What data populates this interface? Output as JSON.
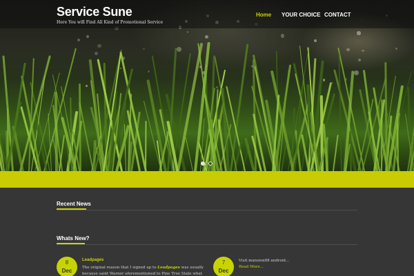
{
  "header": {
    "site_title": "Service Sune",
    "tagline": "Here You will Find All Kind of Promotional Service"
  },
  "nav": [
    {
      "label": "Home",
      "active": true
    },
    {
      "label": "YOUR CHOICE",
      "active": false
    },
    {
      "label": "CONTACT",
      "active": false
    }
  ],
  "slider": {
    "slide_count": 2,
    "active_slide": 1
  },
  "sections": {
    "recent_news": "Recent News",
    "whats_new": "Whats New?"
  },
  "news": [
    {
      "day": "8",
      "month": "Dec",
      "title": "Leadpages",
      "text_before": "The original reason that I signed up to ",
      "link": "Leadpages",
      "text_after": " was usually",
      "text_line2": "because saint Warner aforementioned to Pine Tree State what"
    },
    {
      "day": "7",
      "month": "Dec",
      "title": "Visit mansion88 android...",
      "read_more": "Read More..."
    }
  ],
  "colors": {
    "accent": "#c8d400",
    "background": "#363636",
    "band": "#c8cc00"
  }
}
